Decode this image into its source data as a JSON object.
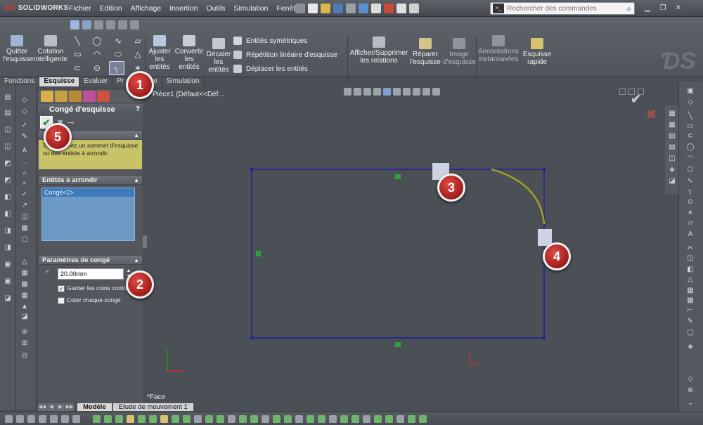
{
  "app": {
    "brand_ds": "ƊS",
    "brand_name": "SOLIDWORKS"
  },
  "menu": {
    "items": [
      "Fichier",
      "Edition",
      "Affichage",
      "Insertion",
      "Outils",
      "Simulation",
      "Fenêtre",
      "?"
    ]
  },
  "search": {
    "placeholder": "Rechercher des commandes"
  },
  "ribbon": {
    "quit_sketch": "Quitter l'esquisse",
    "smart_dimension": "Cotation intelligente",
    "trim": "Ajuster les entités",
    "convert": "Convertir les entités",
    "offset": "Décaler les entités",
    "mirror": "Entités symétriques",
    "linear_pattern": "Répétition linéaire d'esquisse",
    "move": "Déplacer les entités",
    "relations": "Afficher/Supprimer les relations",
    "repair": "Réparer l'esquisse",
    "image": "Image d'esquisse",
    "snaps": "Aimantations instantanées",
    "rapid_sketch": "Esquisse rapide"
  },
  "tabs": [
    "Fonctions",
    "Esquisse",
    "Evaluer",
    "Pr",
    "ce",
    "Simulation"
  ],
  "active_tab": "Esquisse",
  "property_manager": {
    "title": "Congé d'esquisse",
    "help": "?",
    "message": "Sélectionnez un sommet d'esquisse ou des entités à arrondir.",
    "entities_section": "Entités à arrondir",
    "entities": [
      "Congé<2>"
    ],
    "params_section": "Paramètres de congé",
    "radius_value": "20.00mm",
    "keep_corners_label": "Garder les coins contraints",
    "keep_corners_checked": true,
    "dimension_each_label": "Coter chaque congé",
    "dimension_each_checked": false
  },
  "viewport": {
    "tree_label": "Pièce1  (Défaut<<Déf...",
    "view_label": "*Face"
  },
  "model_tabs": [
    "Modèle",
    "Etude de mouvement 1"
  ],
  "callouts": [
    "1",
    "2",
    "3",
    "4",
    "5"
  ],
  "colors": {
    "sketch_line": "#1c1f9a",
    "fillet_arc": "#a8a020",
    "callout_red": "#b8261f",
    "message_bg": "#c8c268",
    "list_selection": "#3f7ab8"
  }
}
